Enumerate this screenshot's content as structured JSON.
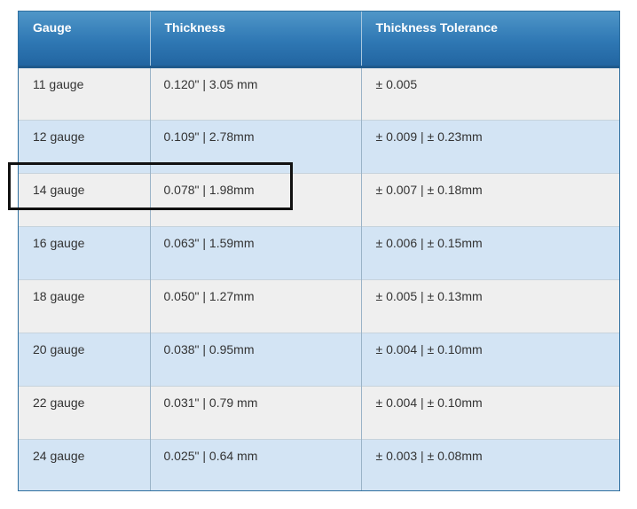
{
  "table": {
    "headers": [
      "Gauge",
      "Thickness",
      "Thickness Tolerance"
    ],
    "rows": [
      {
        "gauge": "11 gauge",
        "thickness": "0.120\" | 3.05 mm",
        "tolerance": "± 0.005"
      },
      {
        "gauge": "12 gauge",
        "thickness": "0.109\" | 2.78mm",
        "tolerance": "± 0.009 | ± 0.23mm"
      },
      {
        "gauge": "14 gauge",
        "thickness": "0.078\" | 1.98mm",
        "tolerance": "± 0.007 | ± 0.18mm"
      },
      {
        "gauge": "16 gauge",
        "thickness": "0.063\" | 1.59mm",
        "tolerance": "± 0.006 | ± 0.15mm"
      },
      {
        "gauge": "18 gauge",
        "thickness": "0.050\" | 1.27mm",
        "tolerance": "± 0.005 | ± 0.13mm"
      },
      {
        "gauge": "20 gauge",
        "thickness": "0.038\" | 0.95mm",
        "tolerance": "± 0.004 | ± 0.10mm"
      },
      {
        "gauge": "22 gauge",
        "thickness": "0.031\" | 0.79 mm",
        "tolerance": "± 0.004 | ± 0.10mm"
      },
      {
        "gauge": "24 gauge",
        "thickness": "0.025\" | 0.64 mm",
        "tolerance": "± 0.003 | ± 0.08mm"
      }
    ],
    "highlighted_row": 2
  },
  "colors": {
    "header_bg": "#2f78b4",
    "row_odd_bg": "#efefef",
    "row_even_bg": "#d3e4f4",
    "highlight_border": "#111111"
  }
}
